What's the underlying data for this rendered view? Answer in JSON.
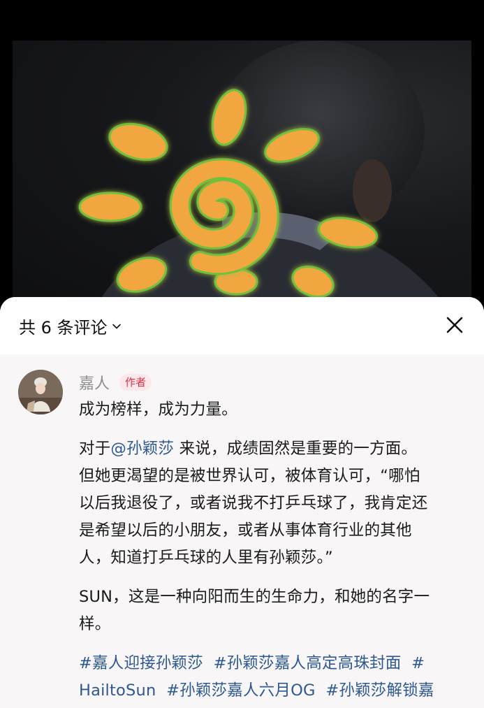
{
  "video": {
    "description_icon": "sun-swirl-illustration"
  },
  "sheet": {
    "comment_count_label": "共 6 条评论",
    "chevron_icon": "chevron-down-icon",
    "close_icon": "close-icon"
  },
  "comment": {
    "author_name": "嘉人",
    "author_badge": "作者",
    "paragraph1": "成为榜样，成为力量。",
    "paragraph2_prefix": "对于",
    "mention": "@孙颖莎",
    "paragraph2_line1_rest": " 来说，成绩固然是重要的一方面。",
    "paragraph2_line2": "但她更渴望的是被世界认可，被体育认可，“哪怕",
    "paragraph2_line3": "以后我退役了，或者说我不打乒乓球了，我肯定还",
    "paragraph2_line4": "是希望以后的小朋友，或者从事体育行业的其他",
    "paragraph2_line5": "人，知道打乒乓球的人里有孙颖莎。”",
    "paragraph3_line1": "SUN，这是一种向阳而生的生命力，和她的名字一",
    "paragraph3_line2": "样。",
    "hashtags_line1": [
      "#嘉人迎接孙颖莎",
      "#孙颖莎嘉人高定高珠封面",
      "#"
    ],
    "hashtags_line2": [
      "HailtoSun",
      "#孙颖莎嘉人六月OG",
      "#孙颖莎解锁嘉"
    ]
  },
  "colors": {
    "link": "#2d5891",
    "badge_text": "#e0314b",
    "badge_bg": "#fce8ea",
    "sun_orange": "#f2a640",
    "sun_glow": "#7fd040"
  }
}
